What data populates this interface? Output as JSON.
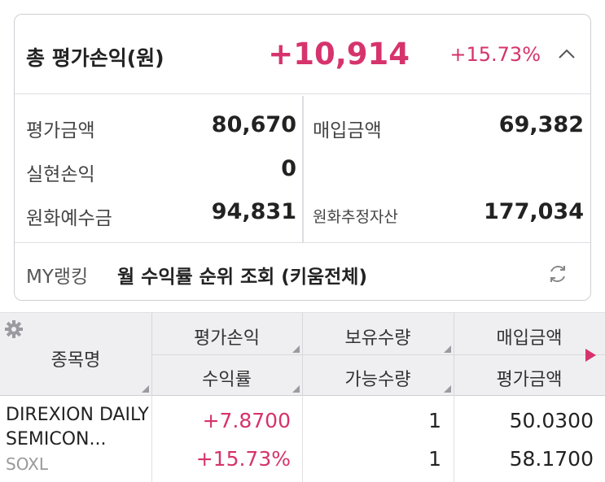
{
  "summary": {
    "title": "총 평가손익(원)",
    "amount": "+10,914",
    "rate": "+15.73%",
    "accent_color": "#d6336c",
    "collapse_icon": "chevron-up-icon"
  },
  "details": {
    "eval_amount_label": "평가금액",
    "eval_amount_value": "80,670",
    "purchase_amount_label": "매입금액",
    "purchase_amount_value": "69,382",
    "realized_pl_label": "실현손익",
    "realized_pl_value": "0",
    "krw_deposit_label": "원화예수금",
    "krw_deposit_value": "94,831",
    "krw_est_assets_label": "원화추정자산",
    "krw_est_assets_value": "177,034"
  },
  "ranking": {
    "label": "MY랭킹",
    "text": "월 수익률 순위 조회 (키움전체)",
    "refresh_icon": "refresh-icon"
  },
  "table": {
    "headers": {
      "name": "종목명",
      "eval_pl": "평가손익",
      "rate": "수익률",
      "holding_qty": "보유수량",
      "available_qty": "가능수량",
      "purchase_amount": "매입금액",
      "eval_amount": "평가금액"
    },
    "rows": [
      {
        "name": "DIREXION DAILY SEMICON...",
        "code": "SOXL",
        "eval_pl": "+7.8700",
        "rate": "+15.73%",
        "holding_qty": "1",
        "available_qty": "1",
        "purchase_amount": "50.0300",
        "eval_amount": "58.1700"
      }
    ]
  }
}
